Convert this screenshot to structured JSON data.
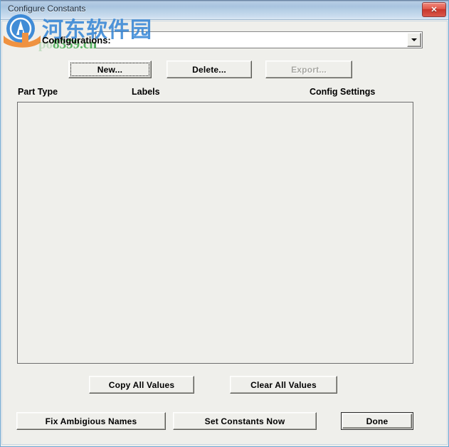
{
  "window": {
    "title": "Configure Constants",
    "close_label": "✕"
  },
  "watermark": {
    "logo_icon": "hedong-logo-icon",
    "cn_text": "河东软件园",
    "url_prefix": "pc",
    "url_faded": "po",
    "url_text": "8359.cn"
  },
  "config_row": {
    "label": "Configurations:",
    "combo_value": "",
    "combo_placeholder": "",
    "dropdown_icon": "chevron-down-icon"
  },
  "top_buttons": [
    {
      "name": "new-button",
      "label": "New...",
      "state": "focused"
    },
    {
      "name": "delete-button",
      "label": "Delete...",
      "state": "normal"
    },
    {
      "name": "export-button",
      "label": "Export...",
      "state": "disabled"
    }
  ],
  "columns": [
    {
      "name": "column-header-part-type",
      "label": "Part Type"
    },
    {
      "name": "column-header-labels",
      "label": "Labels"
    },
    {
      "name": "column-header-config-settings",
      "label": "Config Settings"
    }
  ],
  "list": {
    "rows": []
  },
  "mid_buttons": [
    {
      "name": "copy-all-values-button",
      "label": "Copy All Values"
    },
    {
      "name": "clear-all-values-button",
      "label": "Clear All Values"
    }
  ],
  "bottom_buttons": [
    {
      "name": "fix-ambigious-names-button",
      "label": "Fix Ambigious Names",
      "state": "normal"
    },
    {
      "name": "set-constants-now-button",
      "label": "Set Constants Now",
      "state": "normal"
    },
    {
      "name": "done-button",
      "label": "Done",
      "state": "default"
    }
  ],
  "colors": {
    "window_bg": "#efefeb",
    "title_gradient_top": "#b6cde4",
    "title_gradient_bottom": "#dbe8f4",
    "frame_border": "#6ba7d4",
    "close_red": "#d9574a",
    "watermark_blue": "#2a7fd4",
    "watermark_green": "#3faa4d",
    "list_border": "#6e6e6e"
  }
}
